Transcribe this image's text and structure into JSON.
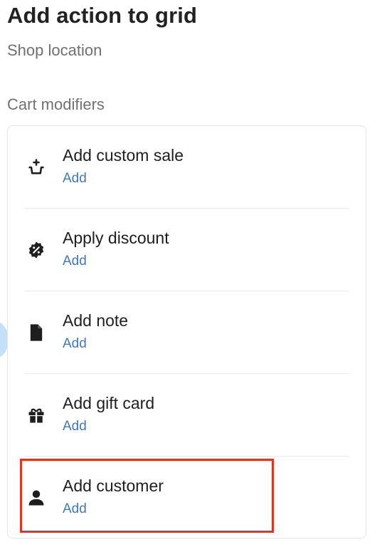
{
  "header": {
    "title": "Add action to grid",
    "subtitle": "Shop location"
  },
  "section": {
    "label": "Cart modifiers"
  },
  "items": [
    {
      "label": "Add custom sale",
      "action": "Add",
      "icon": "basket-plus-icon"
    },
    {
      "label": "Apply discount",
      "action": "Add",
      "icon": "discount-badge-icon"
    },
    {
      "label": "Add note",
      "action": "Add",
      "icon": "note-document-icon"
    },
    {
      "label": "Add gift card",
      "action": "Add",
      "icon": "gift-icon"
    },
    {
      "label": "Add customer",
      "action": "Add",
      "icon": "person-icon"
    }
  ],
  "colors": {
    "link": "#3e78c2",
    "highlight": "#e8321f",
    "muted": "#707070"
  }
}
